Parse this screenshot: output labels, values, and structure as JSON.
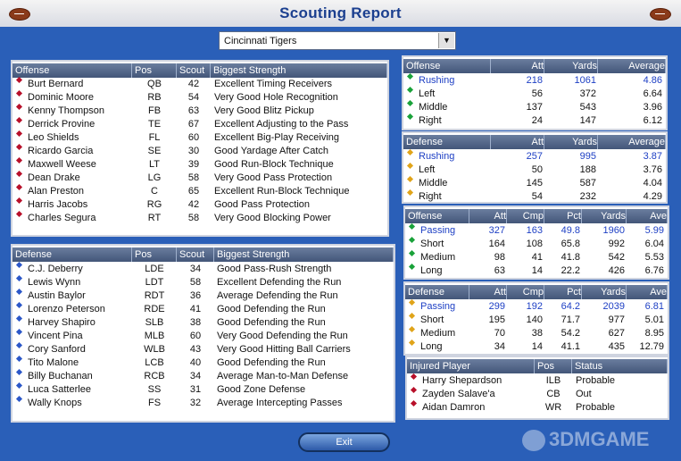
{
  "window": {
    "title": "Scouting Report"
  },
  "team_select": {
    "value": "Cincinnati Tigers"
  },
  "offense_roster": {
    "headers": [
      "Offense",
      "Pos",
      "Scout",
      "Biggest Strength"
    ],
    "rows": [
      {
        "name": "Burt Bernard",
        "pos": "QB",
        "scout": "42",
        "strength": "Excellent Timing Receivers"
      },
      {
        "name": "Dominic Moore",
        "pos": "RB",
        "scout": "54",
        "strength": "Very Good Hole Recognition"
      },
      {
        "name": "Kenny Thompson",
        "pos": "FB",
        "scout": "63",
        "strength": "Very Good Blitz Pickup"
      },
      {
        "name": "Derrick Provine",
        "pos": "TE",
        "scout": "67",
        "strength": "Excellent Adjusting to the Pass"
      },
      {
        "name": "Leo Shields",
        "pos": "FL",
        "scout": "60",
        "strength": "Excellent Big-Play Receiving"
      },
      {
        "name": "Ricardo Garcia",
        "pos": "SE",
        "scout": "30",
        "strength": "Good Yardage After Catch"
      },
      {
        "name": "Maxwell Weese",
        "pos": "LT",
        "scout": "39",
        "strength": "Good Run-Block Technique"
      },
      {
        "name": "Dean Drake",
        "pos": "LG",
        "scout": "58",
        "strength": "Very Good Pass Protection"
      },
      {
        "name": "Alan Preston",
        "pos": "C",
        "scout": "65",
        "strength": "Excellent Run-Block Technique"
      },
      {
        "name": "Harris Jacobs",
        "pos": "RG",
        "scout": "42",
        "strength": "Good Pass Protection"
      },
      {
        "name": "Charles Segura",
        "pos": "RT",
        "scout": "58",
        "strength": "Very Good Blocking Power"
      }
    ]
  },
  "defense_roster": {
    "headers": [
      "Defense",
      "Pos",
      "Scout",
      "Biggest Strength"
    ],
    "rows": [
      {
        "name": "C.J. Deberry",
        "pos": "LDE",
        "scout": "34",
        "strength": "Good Pass-Rush Strength"
      },
      {
        "name": "Lewis Wynn",
        "pos": "LDT",
        "scout": "58",
        "strength": "Excellent Defending the Run"
      },
      {
        "name": "Austin Baylor",
        "pos": "RDT",
        "scout": "36",
        "strength": "Average Defending the Run"
      },
      {
        "name": "Lorenzo Peterson",
        "pos": "RDE",
        "scout": "41",
        "strength": "Good Defending the Run"
      },
      {
        "name": "Harvey Shapiro",
        "pos": "SLB",
        "scout": "38",
        "strength": "Good Defending the Run"
      },
      {
        "name": "Vincent Pina",
        "pos": "MLB",
        "scout": "60",
        "strength": "Very Good Defending the Run"
      },
      {
        "name": "Cory Sanford",
        "pos": "WLB",
        "scout": "43",
        "strength": "Very Good Hitting Ball Carriers"
      },
      {
        "name": "Tito Malone",
        "pos": "LCB",
        "scout": "40",
        "strength": "Good Defending the Run"
      },
      {
        "name": "Billy Buchanan",
        "pos": "RCB",
        "scout": "34",
        "strength": "Average Man-to-Man Defense"
      },
      {
        "name": "Luca Satterlee",
        "pos": "SS",
        "scout": "31",
        "strength": "Good Zone Defense"
      },
      {
        "name": "Wally Knops",
        "pos": "FS",
        "scout": "32",
        "strength": "Average Intercepting Passes"
      }
    ]
  },
  "offense_rushing": {
    "headers": [
      "Offense",
      "Att",
      "Yards",
      "Average"
    ],
    "rows": [
      {
        "label": "Rushing",
        "att": "218",
        "yards": "1061",
        "avg": "4.86",
        "highlight": true
      },
      {
        "label": "Left",
        "att": "56",
        "yards": "372",
        "avg": "6.64"
      },
      {
        "label": "Middle",
        "att": "137",
        "yards": "543",
        "avg": "3.96"
      },
      {
        "label": "Right",
        "att": "24",
        "yards": "147",
        "avg": "6.12"
      }
    ]
  },
  "defense_rushing": {
    "headers": [
      "Defense",
      "Att",
      "Yards",
      "Average"
    ],
    "rows": [
      {
        "label": "Rushing",
        "att": "257",
        "yards": "995",
        "avg": "3.87",
        "highlight": true
      },
      {
        "label": "Left",
        "att": "50",
        "yards": "188",
        "avg": "3.76"
      },
      {
        "label": "Middle",
        "att": "145",
        "yards": "587",
        "avg": "4.04"
      },
      {
        "label": "Right",
        "att": "54",
        "yards": "232",
        "avg": "4.29"
      }
    ]
  },
  "offense_passing": {
    "headers": [
      "Offense",
      "Att",
      "Cmp",
      "Pct",
      "Yards",
      "Ave"
    ],
    "rows": [
      {
        "label": "Passing",
        "att": "327",
        "cmp": "163",
        "pct": "49.8",
        "yards": "1960",
        "ave": "5.99",
        "highlight": true
      },
      {
        "label": "Short",
        "att": "164",
        "cmp": "108",
        "pct": "65.8",
        "yards": "992",
        "ave": "6.04"
      },
      {
        "label": "Medium",
        "att": "98",
        "cmp": "41",
        "pct": "41.8",
        "yards": "542",
        "ave": "5.53"
      },
      {
        "label": "Long",
        "att": "63",
        "cmp": "14",
        "pct": "22.2",
        "yards": "426",
        "ave": "6.76"
      }
    ]
  },
  "defense_passing": {
    "headers": [
      "Defense",
      "Att",
      "Cmp",
      "Pct",
      "Yards",
      "Ave"
    ],
    "rows": [
      {
        "label": "Passing",
        "att": "299",
        "cmp": "192",
        "pct": "64.2",
        "yards": "2039",
        "ave": "6.81",
        "highlight": true
      },
      {
        "label": "Short",
        "att": "195",
        "cmp": "140",
        "pct": "71.7",
        "yards": "977",
        "ave": "5.01"
      },
      {
        "label": "Medium",
        "att": "70",
        "cmp": "38",
        "pct": "54.2",
        "yards": "627",
        "ave": "8.95"
      },
      {
        "label": "Long",
        "att": "34",
        "cmp": "14",
        "pct": "41.1",
        "yards": "435",
        "ave": "12.79"
      }
    ]
  },
  "injured": {
    "headers": [
      "Injured Player",
      "Pos",
      "Status"
    ],
    "rows": [
      {
        "name": "Harry Shepardson",
        "pos": "ILB",
        "status": "Probable"
      },
      {
        "name": "Zayden Salave'a",
        "pos": "CB",
        "status": "Out"
      },
      {
        "name": "Aidan Damron",
        "pos": "WR",
        "status": "Probable"
      }
    ]
  },
  "buttons": {
    "exit": "Exit"
  },
  "watermark": {
    "text": "3DMGAME"
  }
}
